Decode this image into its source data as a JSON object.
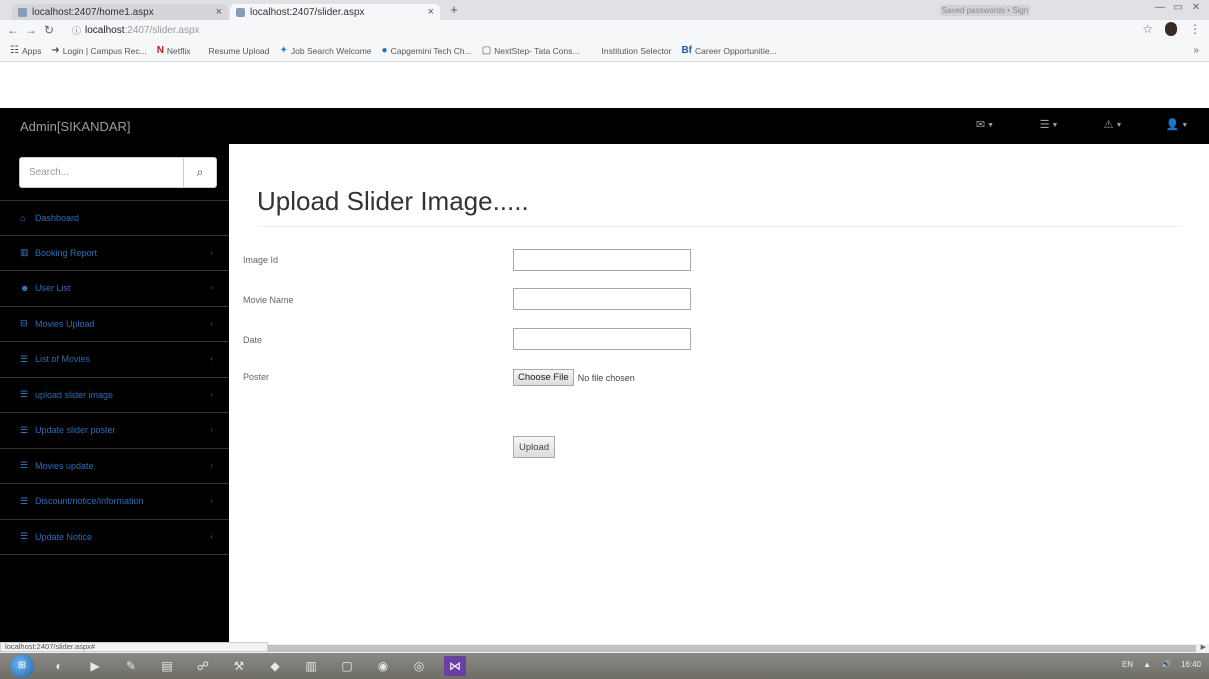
{
  "browser": {
    "tabs": [
      {
        "label": "localhost:2407/home1.aspx",
        "close": "×"
      },
      {
        "label": "localhost:2407/slider.aspx",
        "close": "×"
      }
    ],
    "new_tab": "+",
    "profile_label": "Saved passwords • Sign in",
    "address": {
      "host": "localhost",
      "path": ":2407/slider.aspx"
    },
    "bookmarks": [
      {
        "icon": "☷",
        "label": "Apps"
      },
      {
        "icon": "➜",
        "label": "Login | Campus Rec..."
      },
      {
        "icon": "N",
        "label": "Netflix"
      },
      {
        "icon": "",
        "label": "Resume Upload"
      },
      {
        "icon": "✦",
        "label": "Job Search Welcome"
      },
      {
        "icon": "●",
        "label": "Capgemini Tech Ch..."
      },
      {
        "icon": "▢",
        "label": "NextStep- Tata Cons..."
      },
      {
        "icon": "",
        "label": "Institution Selector"
      },
      {
        "icon": "Bf",
        "label": "Career Opportunitie..."
      }
    ],
    "bookmarks_more": "»",
    "status_url": "localhost:2407/slider.aspx#"
  },
  "app": {
    "brand": "Admin[SIKANDAR]",
    "nav_icons": [
      "✉",
      "☰",
      "⚠",
      "👤"
    ]
  },
  "sidebar": {
    "search_placeholder": "Search...",
    "search_icon": "⌕",
    "items": [
      {
        "icon": "⌂",
        "label": "Dashboard",
        "arrow": ""
      },
      {
        "icon": "▥",
        "label": "Booking Report",
        "arrow": "‹"
      },
      {
        "icon": "☻",
        "label": "User List",
        "arrow": "‹"
      },
      {
        "icon": "⊟",
        "label": "Movies Upload",
        "arrow": "‹"
      },
      {
        "icon": "☰",
        "label": "List of Movies",
        "arrow": "‹"
      },
      {
        "icon": "☰",
        "label": "upload slider image",
        "arrow": "‹"
      },
      {
        "icon": "☰",
        "label": "Update slider poster",
        "arrow": "‹"
      },
      {
        "icon": "☰",
        "label": "Movies update",
        "arrow": "‹"
      },
      {
        "icon": "☰",
        "label": "Discount/notice/information",
        "arrow": "‹"
      },
      {
        "icon": "☰",
        "label": "Update Notice",
        "arrow": "‹"
      }
    ]
  },
  "main": {
    "title": "Upload Slider Image.....",
    "labels": {
      "image_id": "Image Id",
      "movie_name": "Movie Name",
      "date": "Date",
      "poster": "Poster"
    },
    "values": {
      "image_id": "",
      "movie_name": "",
      "date": ""
    },
    "choose_file": "Choose File",
    "no_file": "No file chosen",
    "upload_button": "Upload"
  },
  "taskbar": {
    "tray": [
      "EN",
      "▲",
      "🔊",
      "16:40"
    ]
  }
}
